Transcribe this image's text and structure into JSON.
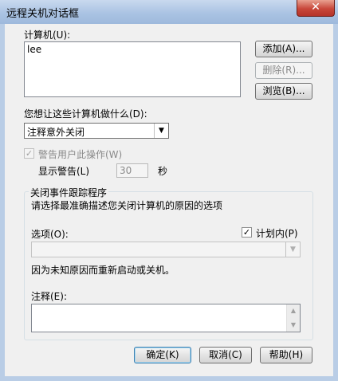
{
  "window": {
    "title": "远程关机对话框",
    "close_glyph": "✕"
  },
  "computers": {
    "label": "计算机(U):",
    "list": [
      "lee"
    ],
    "add_button": "添加(A)...",
    "remove_button": "删除(R)...",
    "browse_button": "浏览(B)..."
  },
  "action": {
    "label": "您想让这些计算机做什么(D):",
    "selected": "注释意外关闭"
  },
  "warn": {
    "checkbox_label": "警告用户此操作(W)",
    "checked": true,
    "display_label": "显示警告(L)",
    "seconds_value": "30",
    "seconds_unit": "秒"
  },
  "tracker": {
    "group_title": "关闭事件跟踪程序",
    "instruction": "请选择最准确描述您关闭计算机的原因的选项",
    "option_label": "选项(O):",
    "planned_label": "计划内(P)",
    "planned_checked": true,
    "option_selected": "",
    "reason_text": "因为未知原因而重新启动或关机。",
    "comment_label": "注释(E):",
    "comment_value": ""
  },
  "footer": {
    "ok_button": "确定(K)",
    "cancel_button": "取消(C)",
    "help_button": "帮助(H)"
  }
}
